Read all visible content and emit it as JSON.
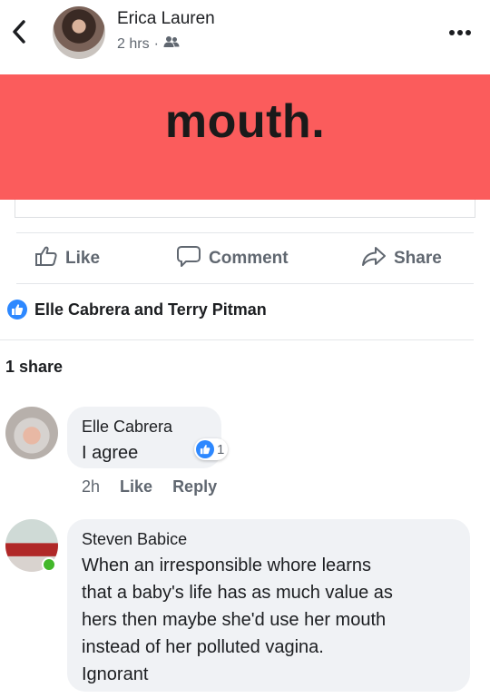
{
  "header": {
    "author_name": "Erica Lauren",
    "time": "2 hrs",
    "separator": "·",
    "audience_icon": "friends-icon",
    "back_icon": "chevron-left-icon",
    "more_icon": "more-dots-icon"
  },
  "post": {
    "banner_text": "mouth.",
    "banner_color": "#fb5c5c"
  },
  "actions": {
    "like_label": "Like",
    "comment_label": "Comment",
    "share_label": "Share"
  },
  "reactions": {
    "names": "Elle Cabrera and Terry Pitman",
    "icon": "like-reaction-icon"
  },
  "shares": {
    "label": "1 share"
  },
  "comments": [
    {
      "author": "Elle Cabrera",
      "text": "I agree",
      "like_count": "1",
      "time": "2h",
      "like_label": "Like",
      "reply_label": "Reply"
    },
    {
      "author": "Steven Babice",
      "text": "When an irresponsible whore learns\nthat a baby's life has as much value as\nhers then maybe she'd use her mouth\ninstead of her polluted vagina.\nIgnorant",
      "online": true
    }
  ],
  "colors": {
    "accent_blue": "#2d88ff",
    "meta_gray": "#606770",
    "online_green": "#42b72a"
  }
}
